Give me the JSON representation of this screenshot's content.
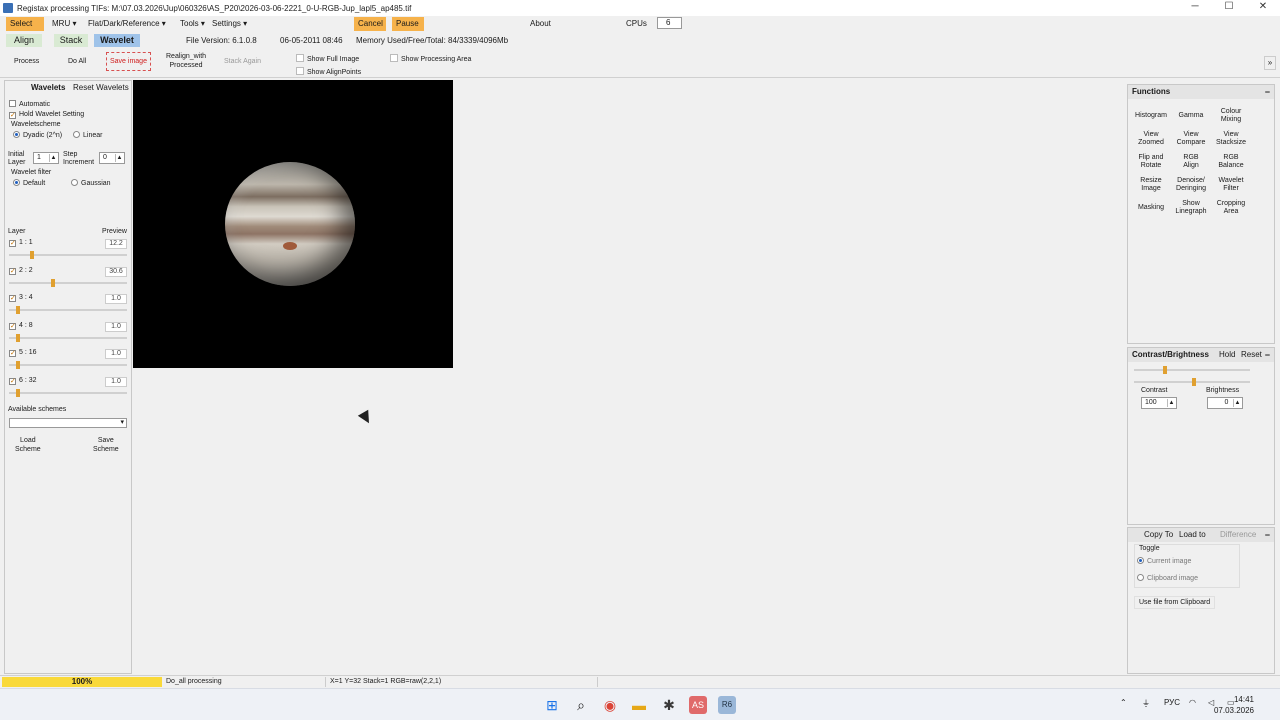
{
  "window": {
    "title": "Registax processing TIFs: M:\\07.03.2026\\Jup\\060326\\AS_P20\\2026-03-06-2221_0-U-RGB-Jup_lapl5_ap485.tif",
    "minimize": "─",
    "maximize": "☐",
    "close": "✕"
  },
  "menu": {
    "select": "Select",
    "mru": "MRU ▾",
    "flat": "Flat/Dark/Reference ▾",
    "tools": "Tools ▾",
    "settings": "Settings ▾",
    "cancel": "Cancel",
    "pause": "Pause",
    "about": "About",
    "cpus_label": "CPUs",
    "cpus_value": "6"
  },
  "tabs": {
    "align": "Align",
    "stack": "Stack",
    "wavelet": "Wavelet"
  },
  "info": {
    "file_version": "File Version: 6.1.0.8",
    "date": "06-05-2011 08:46",
    "memory": "Memory Used/Free/Total: 84/3339/4096Mb"
  },
  "toolbar": {
    "process": "Process",
    "do_all": "Do All",
    "save_image": "Save image",
    "realign_1": "Realign_with",
    "realign_2": "Processed",
    "stack_again": "Stack Again",
    "show_full": "Show Full Image",
    "show_align": "Show AlignPoints",
    "show_processing": "Show Processing Area",
    "expand": "»"
  },
  "wavelets": {
    "tab": "Wavelets",
    "reset": "Reset Wavelets",
    "automatic": "Automatic",
    "hold": "Hold Wavelet Setting",
    "scheme_title": "Waveletscheme",
    "dyadic": "Dyadic (2^n)",
    "linear": "Linear",
    "initial_1": "Initial",
    "initial_2": "Layer",
    "initial_val": "1",
    "step_1": "Step",
    "step_2": "Increment",
    "step_val": "0",
    "filter_title": "Wavelet filter",
    "default": "Default",
    "gaussian": "Gaussian",
    "layer_hdr": "Layer",
    "preview_hdr": "Preview",
    "layers": [
      {
        "label": "1 : 1",
        "value": "12.2",
        "level": 0.18
      },
      {
        "label": "2 : 2",
        "value": "30.6",
        "level": 0.36
      },
      {
        "label": "3 : 4",
        "value": "1.0",
        "level": 0.06
      },
      {
        "label": "4 : 8",
        "value": "1.0",
        "level": 0.06
      },
      {
        "label": "5 : 16",
        "value": "1.0",
        "level": 0.06
      },
      {
        "label": "6 : 32",
        "value": "1.0",
        "level": 0.06
      }
    ],
    "available": "Available schemes",
    "load_1": "Load",
    "load_2": "Scheme",
    "save_1": "Save",
    "save_2": "Scheme"
  },
  "functions": {
    "title": "Functions",
    "buttons": [
      [
        "Histogram",
        ""
      ],
      [
        "Gamma",
        ""
      ],
      [
        "Colour",
        "Mixing"
      ],
      [
        "View",
        "Zoomed"
      ],
      [
        "View",
        "Compare"
      ],
      [
        "View",
        "Stacksize"
      ],
      [
        "Flip and",
        "Rotate"
      ],
      [
        "RGB",
        "Align"
      ],
      [
        "RGB",
        "Balance"
      ],
      [
        "Resize",
        "Image"
      ],
      [
        "Denoise/",
        "Deringing"
      ],
      [
        "Wavelet",
        "Filter"
      ],
      [
        "Masking",
        ""
      ],
      [
        "Show",
        "Linegraph"
      ],
      [
        "Cropping",
        "Area"
      ]
    ]
  },
  "contrast": {
    "title": "Contrast/Brightness",
    "hold": "Hold",
    "reset": "Reset",
    "contrast_lbl": "Contrast",
    "contrast_val": "100",
    "brightness_lbl": "Brightness",
    "brightness_val": "0",
    "contrast_level": 0.25,
    "brightness_level": 0.5
  },
  "copy": {
    "copy_to": "Copy To",
    "load_to": "Load to",
    "difference": "Difference",
    "toggle": "Toggle",
    "current": "Current image",
    "clipboard": "Clipboard image",
    "use_file": "Use file from Clipboard"
  },
  "status": {
    "progress": "100%",
    "progress_level": 1.0,
    "task": "Do_all processing",
    "coords": "X=1 Y=32 Stack=1 RGB=raw(2,2,1)"
  },
  "taskbar": {
    "lang": "РУС",
    "time": "14:41",
    "date": "07.03.2026"
  }
}
